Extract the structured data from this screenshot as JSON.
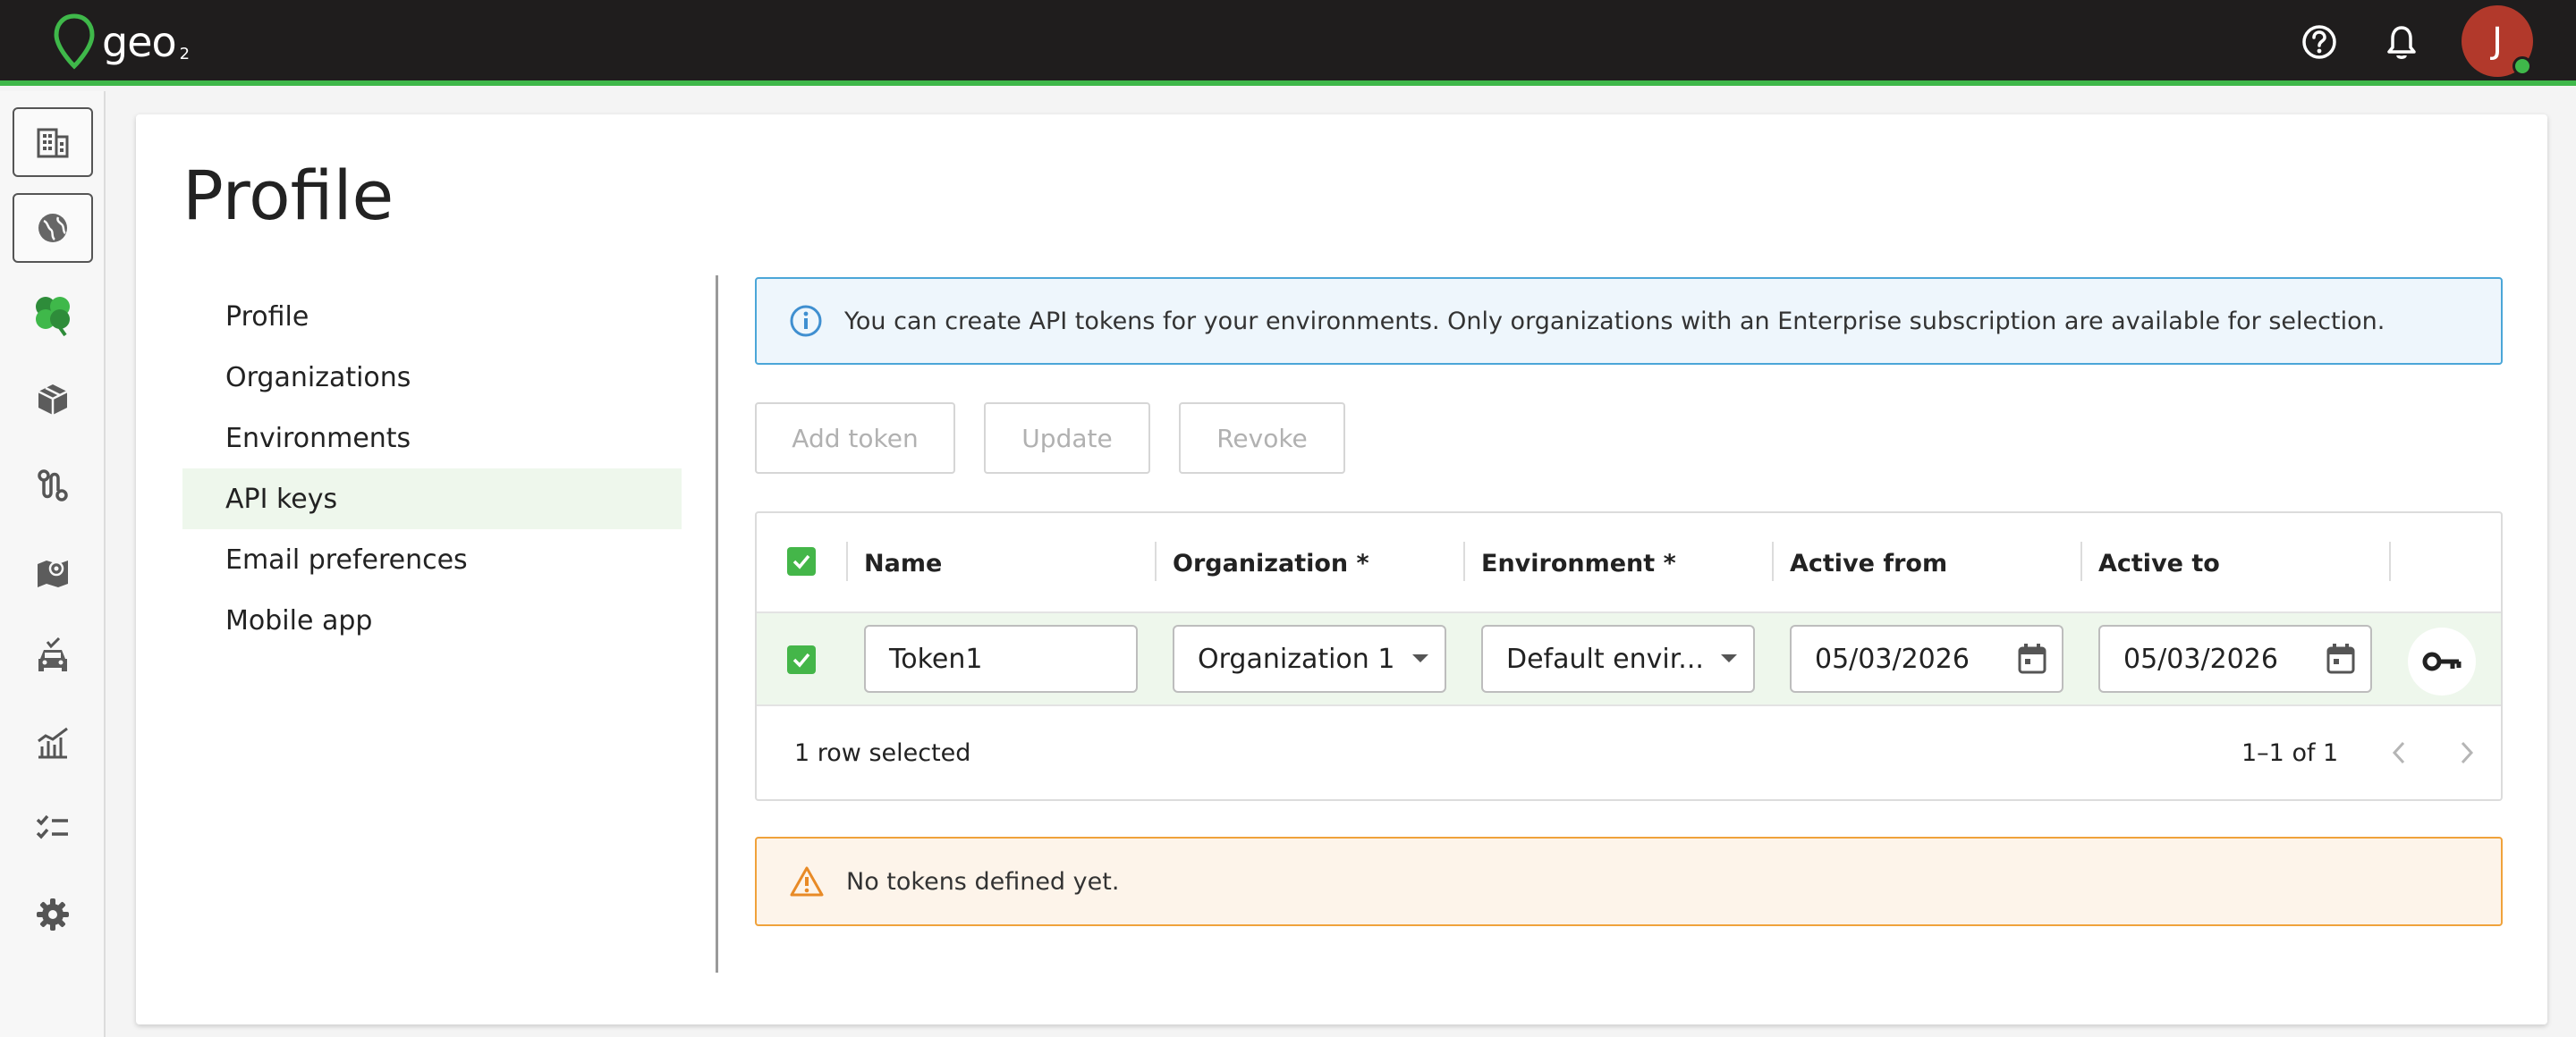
{
  "header": {
    "logo_text": "geo",
    "logo_sub": "2",
    "avatar_initial": "J",
    "icons": [
      "help-icon",
      "bell-icon"
    ]
  },
  "rail": {
    "items": [
      {
        "icon": "building-icon",
        "boxed": true
      },
      {
        "icon": "globe-icon",
        "boxed": true
      },
      {
        "icon": "clover-icon",
        "boxed": false
      },
      {
        "icon": "package-icon",
        "boxed": false
      },
      {
        "icon": "route-icon",
        "boxed": false
      },
      {
        "icon": "map-pin-icon",
        "boxed": false
      },
      {
        "icon": "vehicle-icon",
        "boxed": false
      },
      {
        "icon": "analytics-icon",
        "boxed": false
      },
      {
        "icon": "checklist-icon",
        "boxed": false
      },
      {
        "icon": "settings-icon",
        "boxed": false
      }
    ]
  },
  "page": {
    "title": "Profile"
  },
  "nav": {
    "items": [
      {
        "label": "Profile"
      },
      {
        "label": "Organizations"
      },
      {
        "label": "Environments"
      },
      {
        "label": "API keys",
        "active": true
      },
      {
        "label": "Email preferences"
      },
      {
        "label": "Mobile app"
      }
    ]
  },
  "info": {
    "text": "You can create API tokens for your environments. Only organizations with an Enterprise subscription are available for selection."
  },
  "toolbar": {
    "add_label": "Add token",
    "update_label": "Update",
    "revoke_label": "Revoke"
  },
  "grid": {
    "columns": [
      "Name",
      "Organization *",
      "Environment *",
      "Active from",
      "Active to"
    ],
    "row": {
      "name": "Token1",
      "organization": "Organization 1",
      "environment": "Default envir...",
      "active_from": "05/03/2026",
      "active_to": "05/03/2026"
    },
    "footer": {
      "selected": "1 row selected",
      "range": "1–1 of 1"
    }
  },
  "warning": {
    "text": "No tokens defined yet."
  },
  "colors": {
    "accent": "#3fb84a",
    "topbar": "#1f1d1d",
    "avatar": "#b2392b",
    "info_border": "#4ba6d8",
    "warn_border": "#f0a23b"
  }
}
